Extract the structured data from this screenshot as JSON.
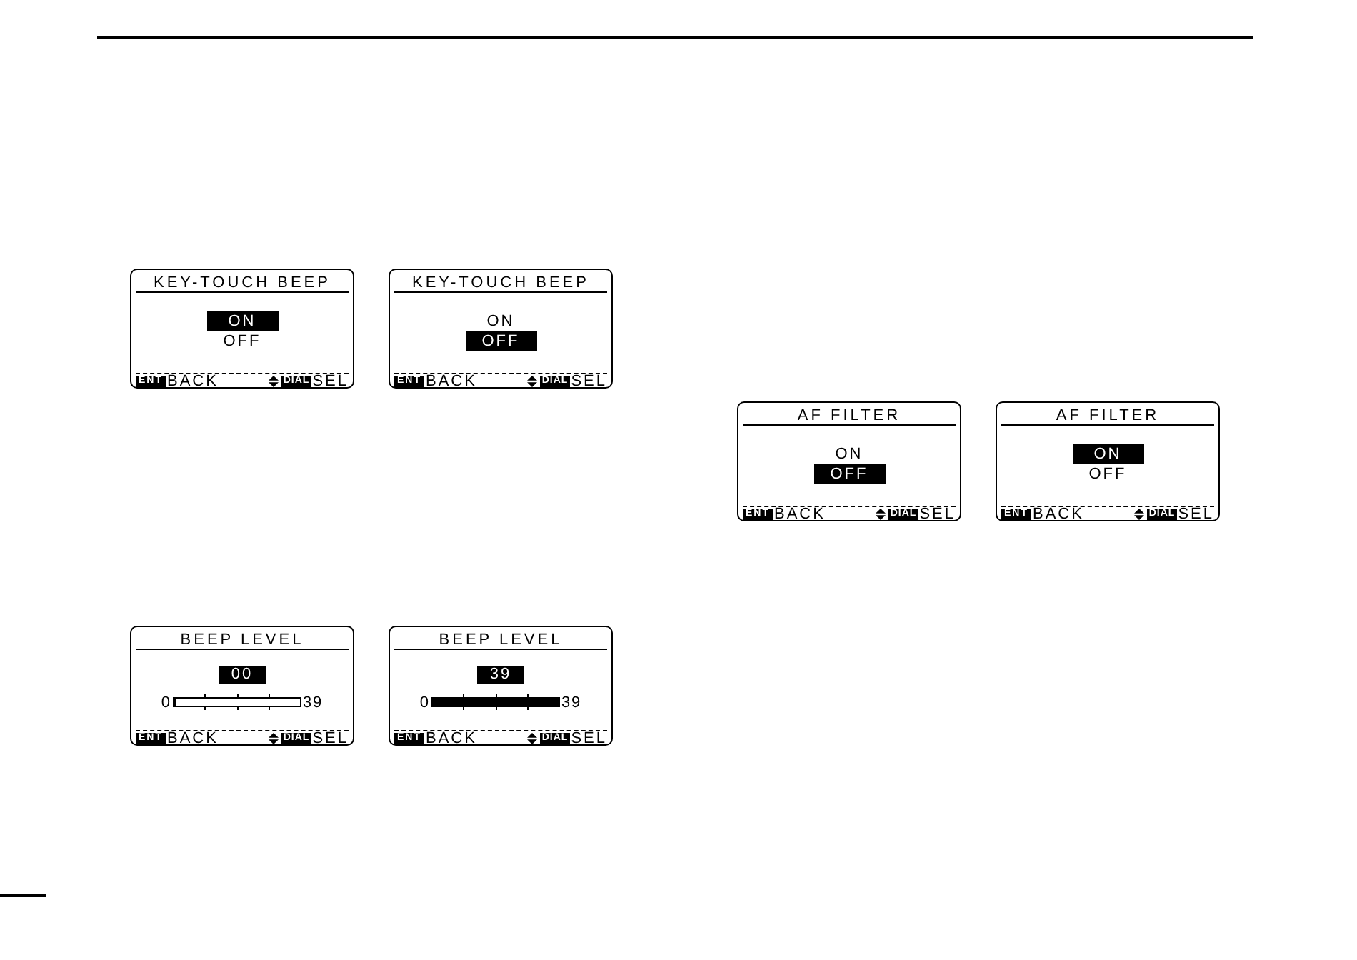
{
  "left_column": {
    "rows": [
      {
        "screens": [
          {
            "kind": "options",
            "title": "KEY-TOUCH BEEP",
            "options": [
              {
                "label": "ON",
                "selected": true
              },
              {
                "label": "OFF",
                "selected": false
              }
            ],
            "footer": {
              "back_key": "ENT",
              "back_label": "BACK",
              "select_key": "DIAL",
              "select_label": "SEL"
            }
          },
          {
            "kind": "options",
            "title": "KEY-TOUCH BEEP",
            "options": [
              {
                "label": "ON",
                "selected": false
              },
              {
                "label": "OFF",
                "selected": true
              }
            ],
            "footer": {
              "back_key": "ENT",
              "back_label": "BACK",
              "select_key": "DIAL",
              "select_label": "SEL"
            }
          }
        ]
      },
      {
        "screens": [
          {
            "kind": "level",
            "title": "BEEP LEVEL",
            "value": "00",
            "scale_min": "0",
            "scale_max": "39",
            "level": 0,
            "footer": {
              "back_key": "ENT",
              "back_label": "BACK",
              "select_key": "DIAL",
              "select_label": "SEL"
            }
          },
          {
            "kind": "level",
            "title": "BEEP LEVEL",
            "value": "39",
            "scale_min": "0",
            "scale_max": "39",
            "level": 1,
            "footer": {
              "back_key": "ENT",
              "back_label": "BACK",
              "select_key": "DIAL",
              "select_label": "SEL"
            }
          }
        ]
      }
    ]
  },
  "right_column": {
    "rows": [
      {
        "screens": [
          {
            "kind": "options",
            "title": "AF FILTER",
            "options": [
              {
                "label": "ON",
                "selected": false
              },
              {
                "label": "OFF",
                "selected": true
              }
            ],
            "footer": {
              "back_key": "ENT",
              "back_label": "BACK",
              "select_key": "DIAL",
              "select_label": "SEL"
            }
          },
          {
            "kind": "options",
            "title": "AF FILTER",
            "options": [
              {
                "label": "ON",
                "selected": true
              },
              {
                "label": "OFF",
                "selected": false
              }
            ],
            "footer": {
              "back_key": "ENT",
              "back_label": "BACK",
              "select_key": "DIAL",
              "select_label": "SEL"
            }
          }
        ]
      }
    ]
  }
}
